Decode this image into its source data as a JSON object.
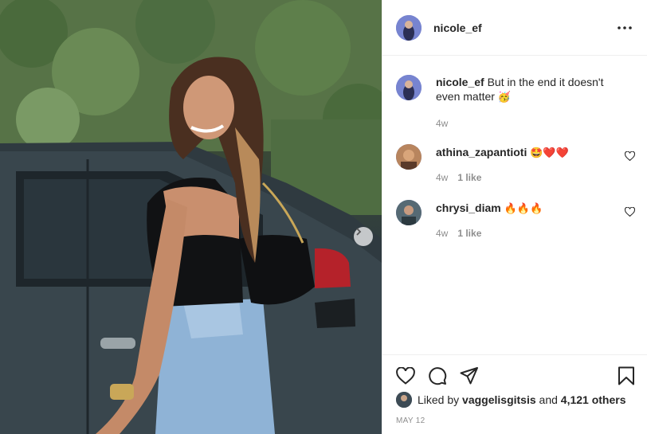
{
  "post": {
    "author": "nicole_ef",
    "caption_author": "nicole_ef",
    "caption_text": "But in the end it doesn't even matter",
    "caption_emoji": "🥳",
    "caption_time": "4w"
  },
  "comments": [
    {
      "user": "athina_zapantioti",
      "text": "🤩❤️❤️",
      "time": "4w",
      "likes": "1 like"
    },
    {
      "user": "chrysi_diam",
      "text": "🔥🔥🔥",
      "time": "4w",
      "likes": "1 like"
    }
  ],
  "likes": {
    "prefix": "Liked by",
    "user": "vaggelisgitsis",
    "middle": "and",
    "count": "4,121 others"
  },
  "date": "MAY 12",
  "icons": {
    "more": "more-horizontal-icon",
    "heart": "heart-icon",
    "comment": "comment-icon",
    "share": "paper-plane-icon",
    "bookmark": "bookmark-icon",
    "next": "chevron-right-icon"
  },
  "colors": {
    "text": "#262626",
    "muted": "#8e8e8e",
    "border": "#efefef",
    "heart_red": "#ed4956"
  }
}
